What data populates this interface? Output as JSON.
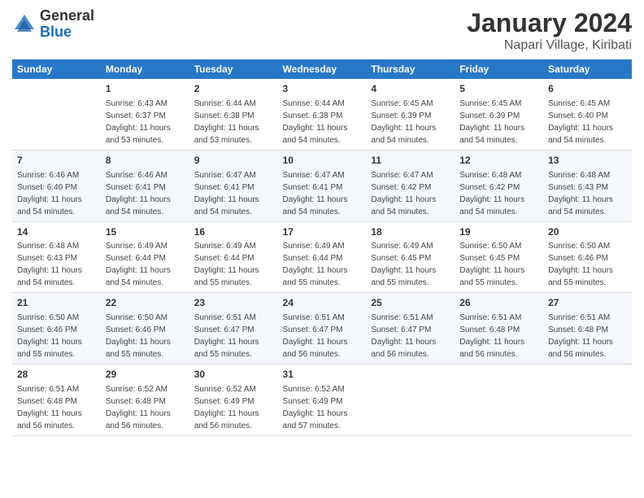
{
  "logo": {
    "general": "General",
    "blue": "Blue"
  },
  "title": "January 2024",
  "subtitle": "Napari Village, Kiribati",
  "weekdays": [
    "Sunday",
    "Monday",
    "Tuesday",
    "Wednesday",
    "Thursday",
    "Friday",
    "Saturday"
  ],
  "weeks": [
    [
      {
        "day": "",
        "sunrise": "",
        "sunset": "",
        "daylight": ""
      },
      {
        "day": "1",
        "sunrise": "Sunrise: 6:43 AM",
        "sunset": "Sunset: 6:37 PM",
        "daylight": "Daylight: 11 hours and 53 minutes."
      },
      {
        "day": "2",
        "sunrise": "Sunrise: 6:44 AM",
        "sunset": "Sunset: 6:38 PM",
        "daylight": "Daylight: 11 hours and 53 minutes."
      },
      {
        "day": "3",
        "sunrise": "Sunrise: 6:44 AM",
        "sunset": "Sunset: 6:38 PM",
        "daylight": "Daylight: 11 hours and 54 minutes."
      },
      {
        "day": "4",
        "sunrise": "Sunrise: 6:45 AM",
        "sunset": "Sunset: 6:39 PM",
        "daylight": "Daylight: 11 hours and 54 minutes."
      },
      {
        "day": "5",
        "sunrise": "Sunrise: 6:45 AM",
        "sunset": "Sunset: 6:39 PM",
        "daylight": "Daylight: 11 hours and 54 minutes."
      },
      {
        "day": "6",
        "sunrise": "Sunrise: 6:45 AM",
        "sunset": "Sunset: 6:40 PM",
        "daylight": "Daylight: 11 hours and 54 minutes."
      }
    ],
    [
      {
        "day": "7",
        "sunrise": "Sunrise: 6:46 AM",
        "sunset": "Sunset: 6:40 PM",
        "daylight": "Daylight: 11 hours and 54 minutes."
      },
      {
        "day": "8",
        "sunrise": "Sunrise: 6:46 AM",
        "sunset": "Sunset: 6:41 PM",
        "daylight": "Daylight: 11 hours and 54 minutes."
      },
      {
        "day": "9",
        "sunrise": "Sunrise: 6:47 AM",
        "sunset": "Sunset: 6:41 PM",
        "daylight": "Daylight: 11 hours and 54 minutes."
      },
      {
        "day": "10",
        "sunrise": "Sunrise: 6:47 AM",
        "sunset": "Sunset: 6:41 PM",
        "daylight": "Daylight: 11 hours and 54 minutes."
      },
      {
        "day": "11",
        "sunrise": "Sunrise: 6:47 AM",
        "sunset": "Sunset: 6:42 PM",
        "daylight": "Daylight: 11 hours and 54 minutes."
      },
      {
        "day": "12",
        "sunrise": "Sunrise: 6:48 AM",
        "sunset": "Sunset: 6:42 PM",
        "daylight": "Daylight: 11 hours and 54 minutes."
      },
      {
        "day": "13",
        "sunrise": "Sunrise: 6:48 AM",
        "sunset": "Sunset: 6:43 PM",
        "daylight": "Daylight: 11 hours and 54 minutes."
      }
    ],
    [
      {
        "day": "14",
        "sunrise": "Sunrise: 6:48 AM",
        "sunset": "Sunset: 6:43 PM",
        "daylight": "Daylight: 11 hours and 54 minutes."
      },
      {
        "day": "15",
        "sunrise": "Sunrise: 6:49 AM",
        "sunset": "Sunset: 6:44 PM",
        "daylight": "Daylight: 11 hours and 54 minutes."
      },
      {
        "day": "16",
        "sunrise": "Sunrise: 6:49 AM",
        "sunset": "Sunset: 6:44 PM",
        "daylight": "Daylight: 11 hours and 55 minutes."
      },
      {
        "day": "17",
        "sunrise": "Sunrise: 6:49 AM",
        "sunset": "Sunset: 6:44 PM",
        "daylight": "Daylight: 11 hours and 55 minutes."
      },
      {
        "day": "18",
        "sunrise": "Sunrise: 6:49 AM",
        "sunset": "Sunset: 6:45 PM",
        "daylight": "Daylight: 11 hours and 55 minutes."
      },
      {
        "day": "19",
        "sunrise": "Sunrise: 6:50 AM",
        "sunset": "Sunset: 6:45 PM",
        "daylight": "Daylight: 11 hours and 55 minutes."
      },
      {
        "day": "20",
        "sunrise": "Sunrise: 6:50 AM",
        "sunset": "Sunset: 6:46 PM",
        "daylight": "Daylight: 11 hours and 55 minutes."
      }
    ],
    [
      {
        "day": "21",
        "sunrise": "Sunrise: 6:50 AM",
        "sunset": "Sunset: 6:46 PM",
        "daylight": "Daylight: 11 hours and 55 minutes."
      },
      {
        "day": "22",
        "sunrise": "Sunrise: 6:50 AM",
        "sunset": "Sunset: 6:46 PM",
        "daylight": "Daylight: 11 hours and 55 minutes."
      },
      {
        "day": "23",
        "sunrise": "Sunrise: 6:51 AM",
        "sunset": "Sunset: 6:47 PM",
        "daylight": "Daylight: 11 hours and 55 minutes."
      },
      {
        "day": "24",
        "sunrise": "Sunrise: 6:51 AM",
        "sunset": "Sunset: 6:47 PM",
        "daylight": "Daylight: 11 hours and 56 minutes."
      },
      {
        "day": "25",
        "sunrise": "Sunrise: 6:51 AM",
        "sunset": "Sunset: 6:47 PM",
        "daylight": "Daylight: 11 hours and 56 minutes."
      },
      {
        "day": "26",
        "sunrise": "Sunrise: 6:51 AM",
        "sunset": "Sunset: 6:48 PM",
        "daylight": "Daylight: 11 hours and 56 minutes."
      },
      {
        "day": "27",
        "sunrise": "Sunrise: 6:51 AM",
        "sunset": "Sunset: 6:48 PM",
        "daylight": "Daylight: 11 hours and 56 minutes."
      }
    ],
    [
      {
        "day": "28",
        "sunrise": "Sunrise: 6:51 AM",
        "sunset": "Sunset: 6:48 PM",
        "daylight": "Daylight: 11 hours and 56 minutes."
      },
      {
        "day": "29",
        "sunrise": "Sunrise: 6:52 AM",
        "sunset": "Sunset: 6:48 PM",
        "daylight": "Daylight: 11 hours and 56 minutes."
      },
      {
        "day": "30",
        "sunrise": "Sunrise: 6:52 AM",
        "sunset": "Sunset: 6:49 PM",
        "daylight": "Daylight: 11 hours and 56 minutes."
      },
      {
        "day": "31",
        "sunrise": "Sunrise: 6:52 AM",
        "sunset": "Sunset: 6:49 PM",
        "daylight": "Daylight: 11 hours and 57 minutes."
      },
      {
        "day": "",
        "sunrise": "",
        "sunset": "",
        "daylight": ""
      },
      {
        "day": "",
        "sunrise": "",
        "sunset": "",
        "daylight": ""
      },
      {
        "day": "",
        "sunrise": "",
        "sunset": "",
        "daylight": ""
      }
    ]
  ]
}
